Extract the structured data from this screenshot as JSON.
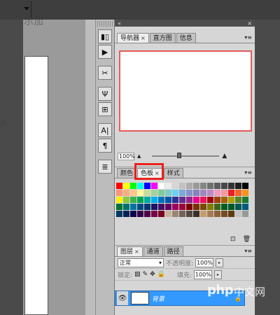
{
  "topbar": {
    "menu_arrow_icon": "triangle-down-icon"
  },
  "ghost_text": {
    "top": "示加",
    "side": "示"
  },
  "toolstrip": {
    "buttons": [
      {
        "icon": "histogram-icon",
        "glyph": "▮▯"
      },
      {
        "icon": "play-action-icon",
        "glyph": "▶"
      },
      {
        "icon": "tools-preset-icon",
        "glyph": "✂"
      },
      {
        "icon": "brush-icon",
        "glyph": "Ψ"
      },
      {
        "icon": "clone-source-icon",
        "glyph": "⊞"
      },
      {
        "icon": "character-icon",
        "glyph": "A|"
      },
      {
        "icon": "paragraph-icon",
        "glyph": "¶"
      },
      {
        "icon": "notes-icon",
        "glyph": "≣"
      }
    ]
  },
  "panel_header": {
    "collapse": "«",
    "close": "×"
  },
  "navigator_panel": {
    "tabs": [
      {
        "label": "导航器",
        "close": "×",
        "active": true
      },
      {
        "label": "直方图",
        "active": false
      },
      {
        "label": "信息",
        "active": false
      }
    ],
    "menu": "▾≡",
    "zoom_value": "100%",
    "zoom_level": 0.4,
    "zoom_out_icon": "mountain-small-icon",
    "zoom_in_icon": "mountain-large-icon"
  },
  "swatches_panel": {
    "tabs": [
      {
        "label": "颜色",
        "active": false
      },
      {
        "label": "色板",
        "close": "×",
        "active": true
      },
      {
        "label": "样式",
        "active": false
      }
    ],
    "menu": "▾≡",
    "new_icon": "new-swatch-icon",
    "delete_icon": "trash-icon",
    "colors": [
      "#ff0000",
      "#ffff00",
      "#00ff00",
      "#00ffff",
      "#0000ff",
      "#ff00ff",
      "#ffffff",
      "#ebebeb",
      "#d6d6d6",
      "#c2c2c2",
      "#adadad",
      "#999999",
      "#858585",
      "#707070",
      "#5c5c5c",
      "#474747",
      "#333333",
      "#1f1f1f",
      "#000000",
      "#f7977a",
      "#f9ad81",
      "#fdc68a",
      "#fff79a",
      "#c4df9b",
      "#a2d39c",
      "#82ca9d",
      "#7bcdc8",
      "#6ecff6",
      "#7ea7d8",
      "#8493ca",
      "#8882be",
      "#a187be",
      "#bc8cbf",
      "#f49ac2",
      "#f6989d",
      "#ed1c24",
      "#f26522",
      "#f7941d",
      "#fff200",
      "#8dc73f",
      "#39b54a",
      "#00a651",
      "#00a99d",
      "#00aeef",
      "#0072bc",
      "#0054a6",
      "#2e3192",
      "#662d91",
      "#92278f",
      "#ec008c",
      "#ed145b",
      "#9e0b0f",
      "#a0410d",
      "#a36209",
      "#aba000",
      "#598527",
      "#1a7b30",
      "#007236",
      "#00746b",
      "#0076a3",
      "#004a80",
      "#003471",
      "#1b1464",
      "#440e62",
      "#630460",
      "#9e005d",
      "#9e0039",
      "#790000",
      "#7b2e00",
      "#7d4900",
      "#827b00",
      "#406618",
      "#005e20",
      "#005826",
      "#005952",
      "#005b7f",
      "#003663",
      "#002157",
      "#0d004c",
      "#32004b",
      "#4b0049",
      "#7b0046",
      "#7a0026",
      "#c7b299",
      "#998675",
      "#736357",
      "#534741",
      "#37302a",
      "#c69c6d",
      "#a67c52",
      "#8c6239",
      "#754c24",
      "#603913",
      "#c2c2c2",
      "#999999"
    ]
  },
  "layers_panel": {
    "tabs": [
      {
        "label": "图层",
        "close": "×",
        "active": true
      },
      {
        "label": "通道",
        "active": false
      },
      {
        "label": "路径",
        "active": false
      }
    ],
    "menu": "▾≡",
    "blend_mode": "正常",
    "opacity_label": "不透明度:",
    "opacity_value": "100%",
    "lock_label": "锁定:",
    "fill_label": "填充:",
    "fill_value": "100%",
    "layer_name": "背景",
    "eye_icon": "eye-icon",
    "lock_icon": "lock-icon"
  },
  "watermark": {
    "site": "php",
    "suffix": "中文网"
  },
  "colors": {
    "highlight": "#e8221c",
    "layer_selected": "#3399ff",
    "nav_border": "#e55b5b"
  }
}
